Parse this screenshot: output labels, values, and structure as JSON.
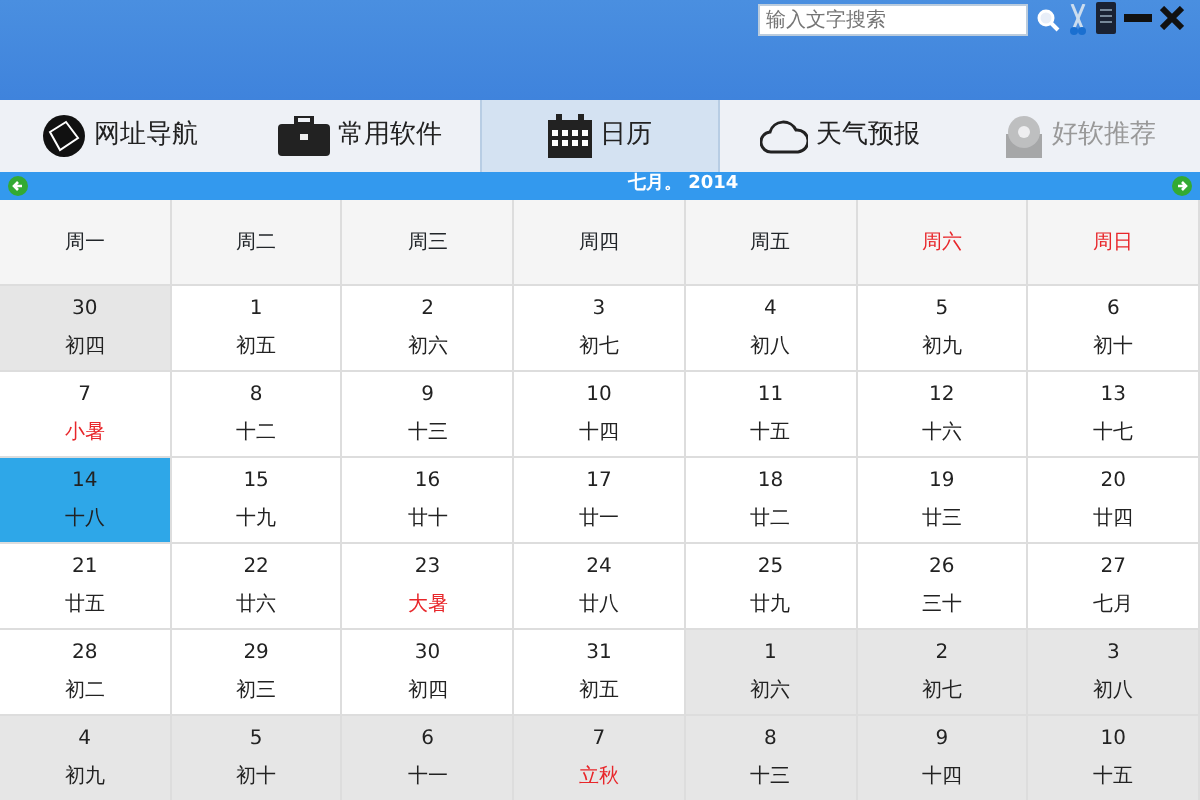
{
  "search": {
    "placeholder": "输入文字搜索"
  },
  "tabs": [
    {
      "label": "网址导航",
      "selected": false,
      "disabled": false
    },
    {
      "label": "常用软件",
      "selected": false,
      "disabled": false
    },
    {
      "label": "日历",
      "selected": true,
      "disabled": false
    },
    {
      "label": "天气预报",
      "selected": false,
      "disabled": false
    },
    {
      "label": "好软推荐",
      "selected": false,
      "disabled": true
    }
  ],
  "month_bar": {
    "title": "七月。 2014"
  },
  "weekdays": [
    {
      "label": "周一",
      "weekend": false
    },
    {
      "label": "周二",
      "weekend": false
    },
    {
      "label": "周三",
      "weekend": false
    },
    {
      "label": "周四",
      "weekend": false
    },
    {
      "label": "周五",
      "weekend": false
    },
    {
      "label": "周六",
      "weekend": true
    },
    {
      "label": "周日",
      "weekend": true
    }
  ],
  "weeks": [
    [
      {
        "day": "30",
        "lunar": "初四",
        "other_month": true,
        "selected": false,
        "term": false
      },
      {
        "day": "1",
        "lunar": "初五",
        "other_month": false,
        "selected": false,
        "term": false
      },
      {
        "day": "2",
        "lunar": "初六",
        "other_month": false,
        "selected": false,
        "term": false
      },
      {
        "day": "3",
        "lunar": "初七",
        "other_month": false,
        "selected": false,
        "term": false
      },
      {
        "day": "4",
        "lunar": "初八",
        "other_month": false,
        "selected": false,
        "term": false
      },
      {
        "day": "5",
        "lunar": "初九",
        "other_month": false,
        "selected": false,
        "term": false
      },
      {
        "day": "6",
        "lunar": "初十",
        "other_month": false,
        "selected": false,
        "term": false
      }
    ],
    [
      {
        "day": "7",
        "lunar": "小暑",
        "other_month": false,
        "selected": false,
        "term": true
      },
      {
        "day": "8",
        "lunar": "十二",
        "other_month": false,
        "selected": false,
        "term": false
      },
      {
        "day": "9",
        "lunar": "十三",
        "other_month": false,
        "selected": false,
        "term": false
      },
      {
        "day": "10",
        "lunar": "十四",
        "other_month": false,
        "selected": false,
        "term": false
      },
      {
        "day": "11",
        "lunar": "十五",
        "other_month": false,
        "selected": false,
        "term": false
      },
      {
        "day": "12",
        "lunar": "十六",
        "other_month": false,
        "selected": false,
        "term": false
      },
      {
        "day": "13",
        "lunar": "十七",
        "other_month": false,
        "selected": false,
        "term": false
      }
    ],
    [
      {
        "day": "14",
        "lunar": "十八",
        "other_month": false,
        "selected": true,
        "term": false
      },
      {
        "day": "15",
        "lunar": "十九",
        "other_month": false,
        "selected": false,
        "term": false
      },
      {
        "day": "16",
        "lunar": "廿十",
        "other_month": false,
        "selected": false,
        "term": false
      },
      {
        "day": "17",
        "lunar": "廿一",
        "other_month": false,
        "selected": false,
        "term": false
      },
      {
        "day": "18",
        "lunar": "廿二",
        "other_month": false,
        "selected": false,
        "term": false
      },
      {
        "day": "19",
        "lunar": "廿三",
        "other_month": false,
        "selected": false,
        "term": false
      },
      {
        "day": "20",
        "lunar": "廿四",
        "other_month": false,
        "selected": false,
        "term": false
      }
    ],
    [
      {
        "day": "21",
        "lunar": "廿五",
        "other_month": false,
        "selected": false,
        "term": false
      },
      {
        "day": "22",
        "lunar": "廿六",
        "other_month": false,
        "selected": false,
        "term": false
      },
      {
        "day": "23",
        "lunar": "大暑",
        "other_month": false,
        "selected": false,
        "term": true
      },
      {
        "day": "24",
        "lunar": "廿八",
        "other_month": false,
        "selected": false,
        "term": false
      },
      {
        "day": "25",
        "lunar": "廿九",
        "other_month": false,
        "selected": false,
        "term": false
      },
      {
        "day": "26",
        "lunar": "三十",
        "other_month": false,
        "selected": false,
        "term": false
      },
      {
        "day": "27",
        "lunar": "七月",
        "other_month": false,
        "selected": false,
        "term": false
      }
    ],
    [
      {
        "day": "28",
        "lunar": "初二",
        "other_month": false,
        "selected": false,
        "term": false
      },
      {
        "day": "29",
        "lunar": "初三",
        "other_month": false,
        "selected": false,
        "term": false
      },
      {
        "day": "30",
        "lunar": "初四",
        "other_month": false,
        "selected": false,
        "term": false
      },
      {
        "day": "31",
        "lunar": "初五",
        "other_month": false,
        "selected": false,
        "term": false
      },
      {
        "day": "1",
        "lunar": "初六",
        "other_month": true,
        "selected": false,
        "term": false
      },
      {
        "day": "2",
        "lunar": "初七",
        "other_month": true,
        "selected": false,
        "term": false
      },
      {
        "day": "3",
        "lunar": "初八",
        "other_month": true,
        "selected": false,
        "term": false
      }
    ],
    [
      {
        "day": "4",
        "lunar": "初九",
        "other_month": true,
        "selected": false,
        "term": false
      },
      {
        "day": "5",
        "lunar": "初十",
        "other_month": true,
        "selected": false,
        "term": false
      },
      {
        "day": "6",
        "lunar": "十一",
        "other_month": true,
        "selected": false,
        "term": false
      },
      {
        "day": "7",
        "lunar": "立秋",
        "other_month": true,
        "selected": false,
        "term": true
      },
      {
        "day": "8",
        "lunar": "十三",
        "other_month": true,
        "selected": false,
        "term": false
      },
      {
        "day": "9",
        "lunar": "十四",
        "other_month": true,
        "selected": false,
        "term": false
      },
      {
        "day": "10",
        "lunar": "十五",
        "other_month": true,
        "selected": false,
        "term": false
      }
    ]
  ]
}
